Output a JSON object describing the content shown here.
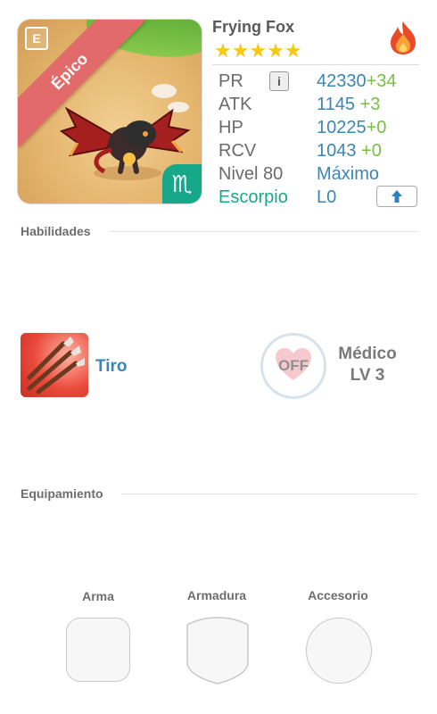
{
  "monster": {
    "name": "Frying Fox",
    "stars": "★★★★★",
    "star_count": 5,
    "rarity_badge": "Épico",
    "e_badge": "E",
    "zodiac_symbol": "♏",
    "element_icon": "fire-icon"
  },
  "stats": [
    {
      "label": "PR",
      "value": "42330",
      "bonus": "+34"
    },
    {
      "label": "ATK",
      "value": "1145",
      "bonus": " +3"
    },
    {
      "label": "HP",
      "value": "10225",
      "bonus": "+0"
    },
    {
      "label": "RCV",
      "value": "1043",
      "bonus": " +0"
    }
  ],
  "level": {
    "label": "Nivel 80",
    "value": "Máximo"
  },
  "sign": {
    "label": "Escorpio",
    "value": "L0"
  },
  "info_icon": "i",
  "sections": {
    "skills_title": "Habilidades",
    "equipment_title": "Equipamiento"
  },
  "skill": {
    "name": "Tiro"
  },
  "leader_skill": {
    "state": "OFF",
    "name": "Médico",
    "level": "LV 3"
  },
  "equipment": {
    "weapon_label": "Arma",
    "armor_label": "Armadura",
    "accessory_label": "Accesorio"
  },
  "colors": {
    "stat_value": "#3a87b5",
    "stat_bonus": "#78c043",
    "sign_green": "#17a88a",
    "rarity_ribbon": "#e26a6a",
    "star": "#f7c71a"
  }
}
